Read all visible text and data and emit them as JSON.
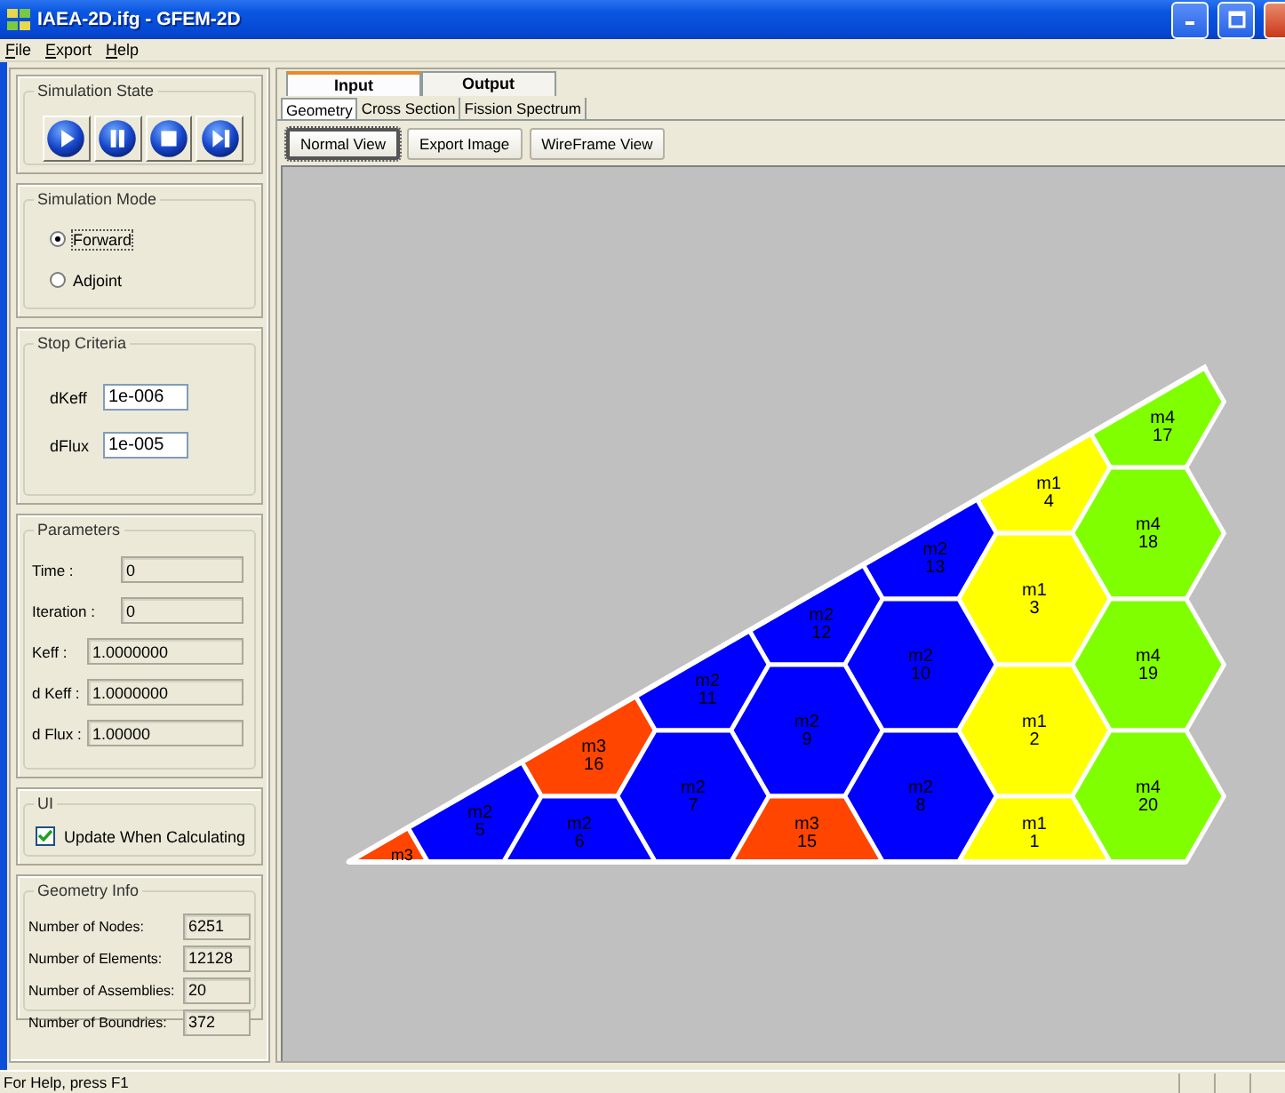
{
  "window": {
    "title": "IAEA-2D.ifg - GFEM-2D"
  },
  "menu": [
    "File",
    "Export",
    "Help"
  ],
  "simulation_state": {
    "title": "Simulation State"
  },
  "simulation_mode": {
    "title": "Simulation Mode",
    "options": [
      {
        "label": "Forward",
        "selected": true
      },
      {
        "label": "Adjoint",
        "selected": false
      }
    ]
  },
  "stop_criteria": {
    "title": "Stop Criteria",
    "fields": [
      {
        "label": "dKeff",
        "value": "1e-006"
      },
      {
        "label": "dFlux",
        "value": "1e-005"
      }
    ]
  },
  "parameters": {
    "title": "Parameters",
    "fields": [
      {
        "label": "Time :",
        "value": "0"
      },
      {
        "label": "Iteration :",
        "value": "0"
      },
      {
        "label": "Keff :",
        "value": "1.0000000"
      },
      {
        "label": "d Keff :",
        "value": "1.0000000"
      },
      {
        "label": "d Flux :",
        "value": "1.00000"
      }
    ]
  },
  "ui": {
    "title": "UI",
    "checkbox": {
      "label": "Update When Calculating",
      "checked": true
    }
  },
  "geometry_info": {
    "title": "Geometry Info",
    "fields": [
      {
        "label": "Number of Nodes:",
        "value": "6251"
      },
      {
        "label": "Number of Elements:",
        "value": "12128"
      },
      {
        "label": "Number of Assemblies:",
        "value": "20"
      },
      {
        "label": "Number of Boundries:",
        "value": "372"
      }
    ]
  },
  "tabs": [
    {
      "label": "Input",
      "selected": true
    },
    {
      "label": "Output",
      "selected": false
    }
  ],
  "subtabs": [
    {
      "label": "Geometry",
      "selected": true
    },
    {
      "label": "Cross Section",
      "selected": false
    },
    {
      "label": "Fission Spectrum",
      "selected": false
    }
  ],
  "view_buttons": [
    {
      "label": "Normal View",
      "focused": true
    },
    {
      "label": "Export Image",
      "focused": false
    },
    {
      "label": "WireFrame View",
      "focused": false
    }
  ],
  "assemblies": [
    {
      "material": "m4",
      "number": "17",
      "color": "#80ff00"
    },
    {
      "material": "m1",
      "number": "4",
      "color": "#ffff00"
    },
    {
      "material": "m2",
      "number": "13",
      "color": "#0000ff"
    },
    {
      "material": "m4",
      "number": "18",
      "color": "#80ff00"
    },
    {
      "material": "m2",
      "number": "12",
      "color": "#0000ff"
    },
    {
      "material": "m1",
      "number": "3",
      "color": "#ffff00"
    },
    {
      "material": "m2",
      "number": "11",
      "color": "#0000ff"
    },
    {
      "material": "m2",
      "number": "10",
      "color": "#0000ff"
    },
    {
      "material": "m4",
      "number": "19",
      "color": "#80ff00"
    },
    {
      "material": "m3",
      "number": "16",
      "color": "#ff4500"
    },
    {
      "material": "m2",
      "number": "9",
      "color": "#0000ff"
    },
    {
      "material": "m1",
      "number": "2",
      "color": "#ffff00"
    },
    {
      "material": "m2",
      "number": "5",
      "color": "#0000ff"
    },
    {
      "material": "m2",
      "number": "7",
      "color": "#0000ff"
    },
    {
      "material": "m2",
      "number": "8",
      "color": "#0000ff"
    },
    {
      "material": "m4",
      "number": "20",
      "color": "#80ff00"
    },
    {
      "material": "m3",
      "color": "#ff4500"
    },
    {
      "material": "m2",
      "number": "6",
      "color": "#0000ff"
    },
    {
      "material": "m3",
      "number": "15",
      "color": "#ff4500"
    },
    {
      "material": "m1",
      "number": "1",
      "color": "#ffff00"
    }
  ],
  "status_bar": {
    "text": "For Help, press F1"
  }
}
